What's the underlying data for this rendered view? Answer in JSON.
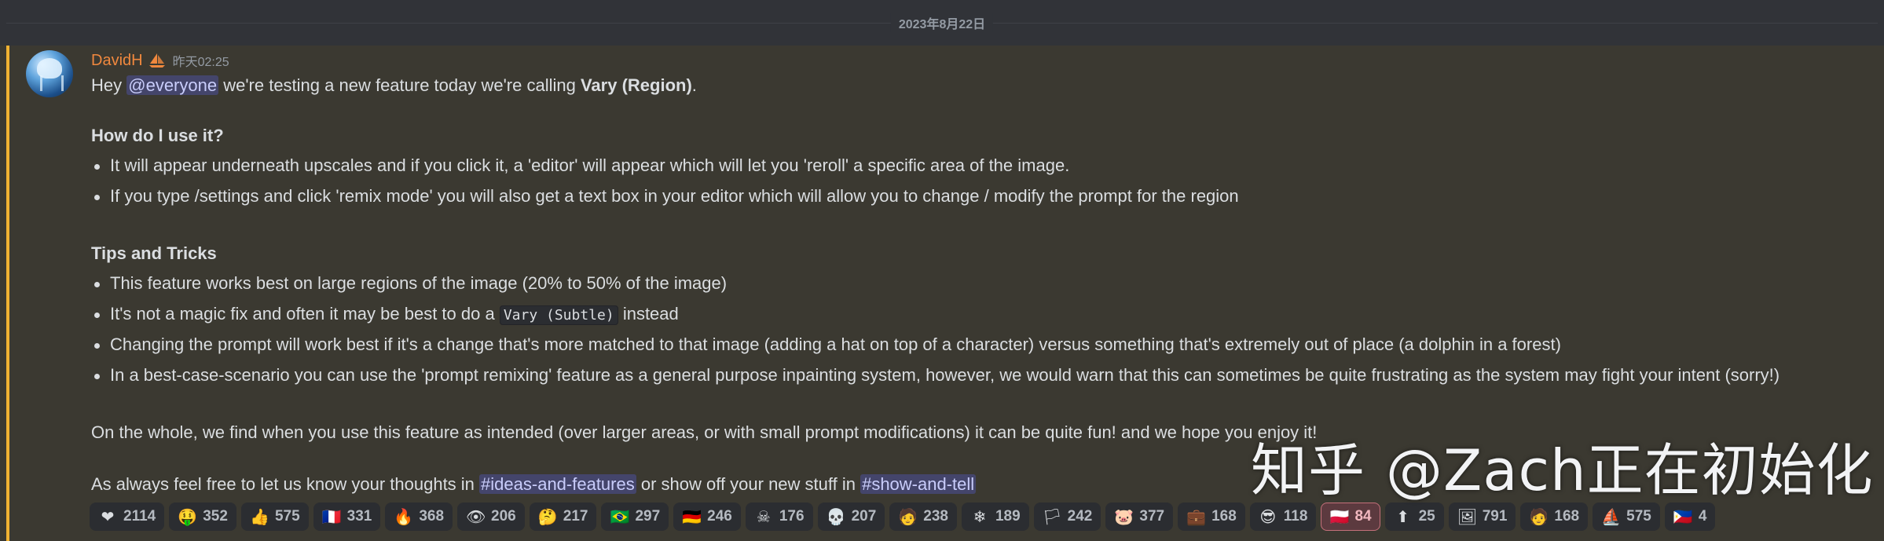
{
  "date_divider": "2023年8月22日",
  "message": {
    "author": "DavidH",
    "timestamp": "昨天02:25",
    "intro_pre": "Hey ",
    "intro_mention": "@everyone",
    "intro_mid": " we're testing a new feature today we're calling ",
    "intro_bold": "Vary (Region)",
    "intro_end": ".",
    "heading1": "How do I use it?",
    "use_bullets": [
      "It will appear underneath upscales and if you click it, a 'editor' will appear which will let you 'reroll' a specific area of the image.",
      "If you type /settings and click 'remix mode' you will also get a text box in your editor which will allow you to change / modify the prompt for the region"
    ],
    "heading2": "Tips and Tricks",
    "tip1": "This feature works best on large regions of the image (20% to 50% of the image)",
    "tip2_pre": "It's not a magic fix and often it may be best to do a ",
    "tip2_code": "Vary (Subtle)",
    "tip2_post": " instead",
    "tip3": "Changing the prompt will work best if it's a change that's more matched to that image (adding a hat on top of a character) versus something that's extremely out of place (a dolphin in a forest)",
    "tip4": "In a best-case-scenario you can use the 'prompt remixing' feature as a general purpose inpainting system, however, we would warn that this can sometimes be quite frustrating as the system may fight your intent (sorry!)",
    "whole": "On the whole, we find when you use this feature as intended (over larger areas, or with small prompt modifications) it can be quite fun! and we hope you enjoy it!",
    "outro_pre": "As always feel free to let us know your thoughts in ",
    "outro_channel1": "#ideas-and-features",
    "outro_mid": " or show off your new stuff in ",
    "outro_channel2": "#show-and-tell"
  },
  "reactions": [
    {
      "emoji": "❤",
      "icon": "red-heart-icon",
      "count": "2114"
    },
    {
      "emoji": "🤑",
      "icon": "money-face-icon",
      "count": "352"
    },
    {
      "emoji": "👍",
      "icon": "thumbs-up-icon",
      "count": "575"
    },
    {
      "emoji": "🇫🇷",
      "icon": "flag-france-icon",
      "count": "331"
    },
    {
      "emoji": "🔥",
      "icon": "fire-icon",
      "count": "368"
    },
    {
      "emoji": "👁",
      "icon": "eye-icon",
      "count": "206"
    },
    {
      "emoji": "🤔",
      "icon": "thinking-face-icon",
      "count": "217"
    },
    {
      "emoji": "🇧🇷",
      "icon": "flag-brazil-icon",
      "count": "297"
    },
    {
      "emoji": "🇩🇪",
      "icon": "flag-germany-icon",
      "count": "246"
    },
    {
      "emoji": "☠",
      "icon": "skull-crossbones-icon",
      "count": "176"
    },
    {
      "emoji": "💀",
      "icon": "skull-icon",
      "count": "207"
    },
    {
      "emoji": "🧑",
      "icon": "custom-face-icon",
      "count": "238"
    },
    {
      "emoji": "❄",
      "icon": "snowflake-icon",
      "count": "189"
    },
    {
      "emoji": "🏳",
      "icon": "rainbow-flag-icon",
      "count": "242"
    },
    {
      "emoji": "🐷",
      "icon": "pink-blob-icon",
      "count": "377"
    },
    {
      "emoji": "💼",
      "icon": "briefcase-icon",
      "count": "168"
    },
    {
      "emoji": "😎",
      "icon": "sunglasses-face-icon",
      "count": "118"
    },
    {
      "emoji": "🇵🇱",
      "icon": "flag-poland-icon",
      "count": "84",
      "me": true
    },
    {
      "emoji": "⬆",
      "icon": "up-this-icon",
      "count": "25"
    },
    {
      "emoji": "🖼",
      "icon": "rainbow-frame-icon",
      "count": "791"
    },
    {
      "emoji": "🧑",
      "icon": "custom-face-2-icon",
      "count": "168"
    },
    {
      "emoji": "⛵",
      "icon": "midjourney-boat-icon",
      "count": "575"
    },
    {
      "emoji": "🇵🇭",
      "icon": "flag-philippines-icon",
      "count": "4"
    }
  ],
  "watermark": {
    "brand": "知乎",
    "handle": "@Zach正在初始化"
  }
}
